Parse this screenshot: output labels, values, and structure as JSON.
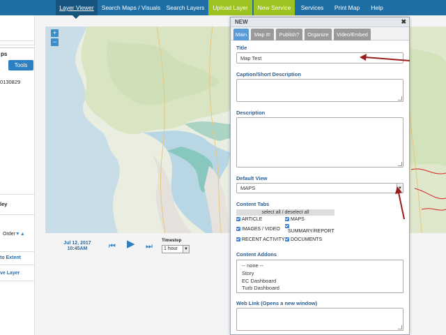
{
  "nav": {
    "items": [
      {
        "label": "Layer Viewer"
      },
      {
        "label": "Search Maps / Visuals"
      },
      {
        "label": "Search Layers"
      },
      {
        "label": "Upload Layer"
      },
      {
        "label": "New Service"
      },
      {
        "label": "Services"
      },
      {
        "label": "Print Map"
      },
      {
        "label": "Help"
      }
    ],
    "colors": {
      "bar": "#1f6ea6",
      "active": "#17557f",
      "green": "#9cc31f"
    }
  },
  "left_panel": {
    "tab_label": "ps",
    "tools_label": "Tools",
    "id_text": "0130829",
    "ley_text": "ley",
    "order_text": "Order",
    "extent_link": "to Extent",
    "layer_link": "ve Layer"
  },
  "map": {
    "zoom_in": "+",
    "zoom_out": "−"
  },
  "timeline": {
    "date": "Jul 12, 2017",
    "time": "10:45AM",
    "timestep_label": "Timestep",
    "timestep_value": "1 hour"
  },
  "dialog": {
    "title": "NEW",
    "close": "✖",
    "tabs": [
      {
        "label": "Main"
      },
      {
        "label": "Map It!"
      },
      {
        "label": "Publish?"
      },
      {
        "label": "Organize"
      },
      {
        "label": "Video/Embed"
      }
    ],
    "title_label": "Title",
    "title_value": "Map Test",
    "caption_label": "Caption/Short Description",
    "description_label": "Description",
    "default_view_label": "Default View",
    "default_view_value": "MAPS",
    "content_tabs_label": "Content Tabs",
    "select_all_label": "select all / deselect all",
    "content_tabs": [
      {
        "label": "ARTICLE"
      },
      {
        "label": "MAPS"
      },
      {
        "label": "IMAGES / VIDEO"
      },
      {
        "label": "SUMMARY/REPORT"
      },
      {
        "label": "RECENT ACTIVITY"
      },
      {
        "label": "DOCUMENTS"
      }
    ],
    "content_addons_label": "Content Addons",
    "addons": [
      "-- none --",
      "Story",
      "EC Dashboard",
      "Turb Dashboard"
    ],
    "weblink_label": "Web Link (Opens a new window)",
    "colors": {
      "label": "#2a5d8f",
      "tab_active": "#5b9bd5",
      "tab": "#9a9a9a"
    }
  }
}
